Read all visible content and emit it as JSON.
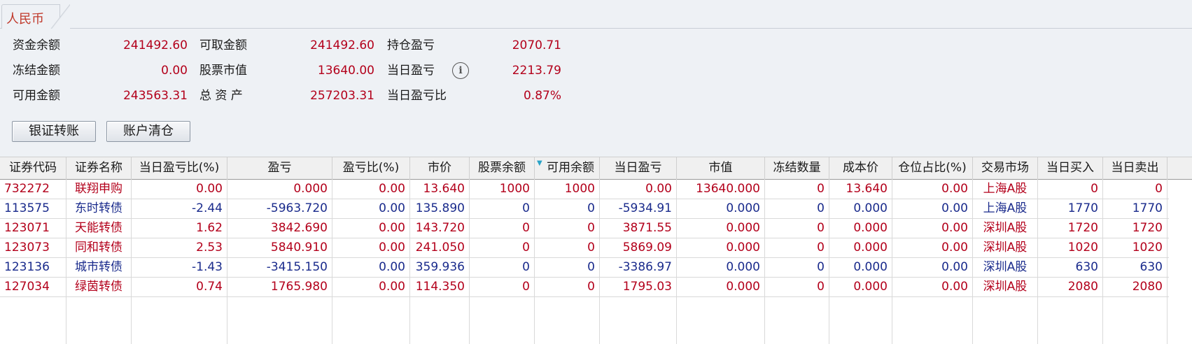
{
  "tab": {
    "label": "人民币"
  },
  "summary": {
    "row1": [
      {
        "label": "资金余额",
        "value": "241492.60"
      },
      {
        "label": "可取金额",
        "value": "241492.60"
      },
      {
        "label": "持仓盈亏",
        "value": "2070.71"
      }
    ],
    "row2": [
      {
        "label": "冻结金额",
        "value": "0.00"
      },
      {
        "label": "股票市值",
        "value": "13640.00"
      },
      {
        "label": "当日盈亏",
        "value": "2213.79"
      }
    ],
    "row3": [
      {
        "label": "可用金额",
        "value": "243563.31"
      },
      {
        "label": "总 资 产",
        "value": "257203.31"
      },
      {
        "label": "当日盈亏比",
        "value": "0.87%"
      }
    ],
    "info_icon_glyph": "i"
  },
  "buttons": {
    "transfer": "银证转账",
    "clear": "账户清仓"
  },
  "colors": {
    "positive": "#b3001b",
    "negative": "#1a2b8c"
  },
  "table": {
    "columns": [
      "证券代码",
      "证券名称",
      "当日盈亏比(%)",
      "盈亏",
      "盈亏比(%)",
      "市价",
      "股票余额",
      "可用余额",
      "当日盈亏",
      "市值",
      "冻结数量",
      "成本价",
      "仓位占比(%)",
      "交易市场",
      "当日买入",
      "当日卖出"
    ],
    "sort_icon": "sort-descending-icon",
    "rows": [
      {
        "tone": "red",
        "cells": [
          "732272",
          "联翔申购",
          "0.00",
          "0.000",
          "0.00",
          "13.640",
          "1000",
          "1000",
          "0.00",
          "13640.000",
          "0",
          "13.640",
          "0.00",
          "上海A股",
          "0",
          "0"
        ]
      },
      {
        "tone": "blue",
        "cells": [
          "113575",
          "东时转债",
          "-2.44",
          "-5963.720",
          "0.00",
          "135.890",
          "0",
          "0",
          "-5934.91",
          "0.000",
          "0",
          "0.000",
          "0.00",
          "上海A股",
          "1770",
          "1770"
        ]
      },
      {
        "tone": "red",
        "cells": [
          "123071",
          "天能转债",
          "1.62",
          "3842.690",
          "0.00",
          "143.720",
          "0",
          "0",
          "3871.55",
          "0.000",
          "0",
          "0.000",
          "0.00",
          "深圳A股",
          "1720",
          "1720"
        ]
      },
      {
        "tone": "red",
        "cells": [
          "123073",
          "同和转债",
          "2.53",
          "5840.910",
          "0.00",
          "241.050",
          "0",
          "0",
          "5869.09",
          "0.000",
          "0",
          "0.000",
          "0.00",
          "深圳A股",
          "1020",
          "1020"
        ]
      },
      {
        "tone": "blue",
        "cells": [
          "123136",
          "城市转债",
          "-1.43",
          "-3415.150",
          "0.00",
          "359.936",
          "0",
          "0",
          "-3386.97",
          "0.000",
          "0",
          "0.000",
          "0.00",
          "深圳A股",
          "630",
          "630"
        ]
      },
      {
        "tone": "red",
        "cells": [
          "127034",
          "绿茵转债",
          "0.74",
          "1765.980",
          "0.00",
          "114.350",
          "0",
          "0",
          "1795.03",
          "0.000",
          "0",
          "0.000",
          "0.00",
          "深圳A股",
          "2080",
          "2080"
        ]
      }
    ]
  }
}
